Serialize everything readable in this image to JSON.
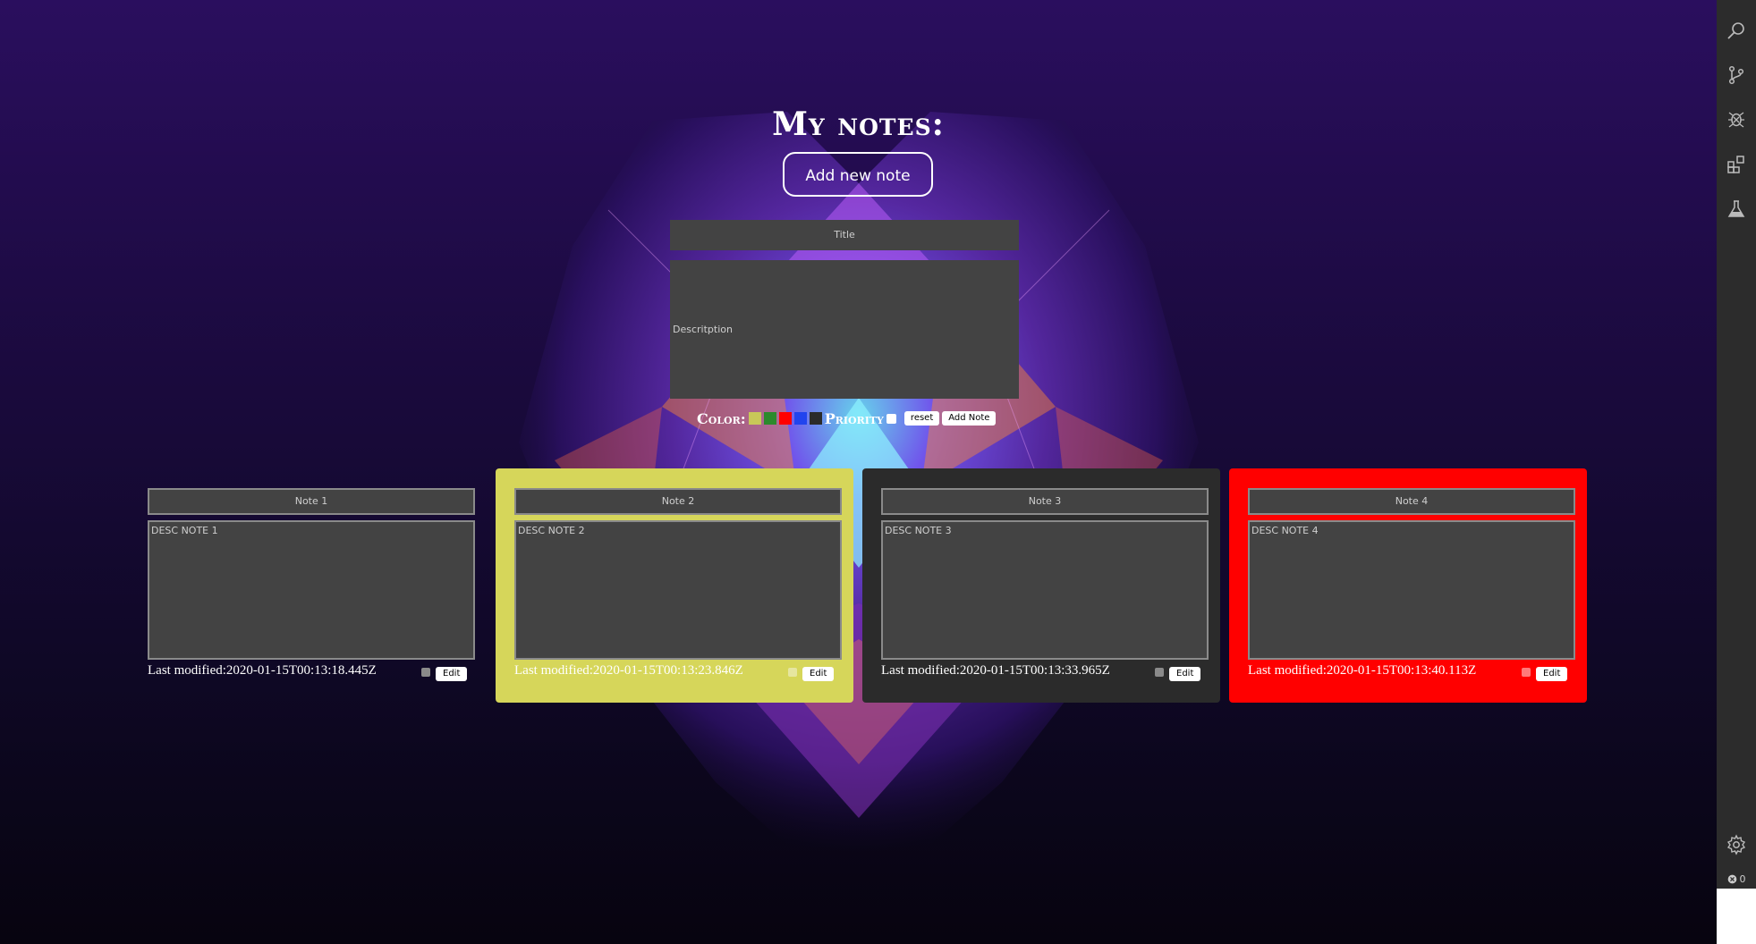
{
  "page": {
    "title": "My notes:",
    "add_new_label": "Add new note"
  },
  "form": {
    "title_placeholder": "Title",
    "description_placeholder": "Descritption",
    "color_label": "Color:",
    "priority_label": "Priority",
    "reset_label": "reset",
    "add_label": "Add Note",
    "swatches": [
      "#c8c858",
      "#2c8a2c",
      "#ff0000",
      "#2244ee",
      "#2b2b2b"
    ]
  },
  "notes": [
    {
      "title": "Note 1",
      "description": "DESC NOTE 1",
      "modified": "Last modified:2020-01-15T00:13:18.445Z",
      "edit_label": "Edit",
      "color": "transparent"
    },
    {
      "title": "Note 2",
      "description": "DESC NOTE 2",
      "modified": "Last modified:2020-01-15T00:13:23.846Z",
      "edit_label": "Edit",
      "color": "#d6d65a"
    },
    {
      "title": "Note 3",
      "description": "DESC NOTE 3",
      "modified": "Last modified:2020-01-15T00:13:33.965Z",
      "edit_label": "Edit",
      "color": "#2b2b2b"
    },
    {
      "title": "Note 4",
      "description": "DESC NOTE 4",
      "modified": "Last modified:2020-01-15T00:13:40.113Z",
      "edit_label": "Edit",
      "color": "#ff0000"
    }
  ],
  "activity_bar": {
    "icons": [
      "search-icon",
      "source-control-icon",
      "debug-icon",
      "extensions-icon",
      "testing-icon",
      "settings-gear-icon"
    ],
    "error_count": "0"
  }
}
